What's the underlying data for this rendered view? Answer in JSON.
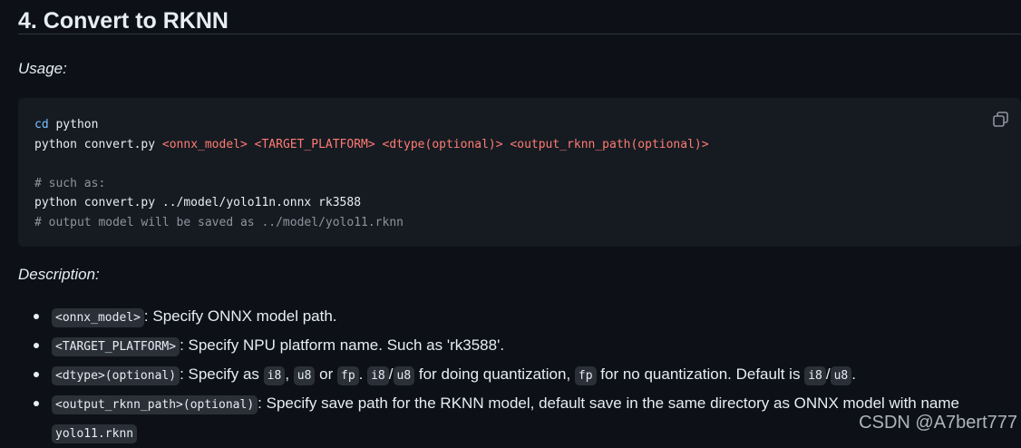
{
  "section": {
    "heading": "4. Convert to RKNN"
  },
  "usage_label": "Usage:",
  "code_block": {
    "line1_cmd": "cd",
    "line1_arg": " python",
    "line2_prefix": "python convert.py ",
    "line2_ph1": "<onnx_model>",
    "line2_ph2": "<TARGET_PLATFORM>",
    "line2_ph3": "<dtype(optional)>",
    "line2_ph4": "<output_rknn_path(optional)>",
    "line4_comment": "# such as:",
    "line5": "python convert.py ../model/yolo11n.onnx rk3588",
    "line6_comment": "# output model will be saved as ../model/yolo11.rknn",
    "copy_icon": "copy-icon"
  },
  "description_label": "Description:",
  "items": [
    {
      "code": "<onnx_model>",
      "text": ": Specify ONNX model path."
    },
    {
      "code": "<TARGET_PLATFORM>",
      "text": ": Specify NPU platform name. Such as 'rk3588'."
    },
    {
      "code": "<dtype>(optional)",
      "t1": ": Specify as ",
      "c1": "i8",
      "t2": ", ",
      "c2": "u8",
      "t3": " or ",
      "c3": "fp",
      "t4": ". ",
      "c4": "i8",
      "t5": "/",
      "c5": "u8",
      "t6": " for doing quantization, ",
      "c6": "fp",
      "t7": " for no quantization. Default is ",
      "c7": "i8",
      "t8": "/",
      "c8": "u8",
      "t9": "."
    },
    {
      "code": "<output_rknn_path>(optional)",
      "text": ": Specify save path for the RKNN model, default save in the same directory as ONNX model with name ",
      "code2": "yolo11.rknn"
    }
  ],
  "watermark": "CSDN @A7bert777"
}
